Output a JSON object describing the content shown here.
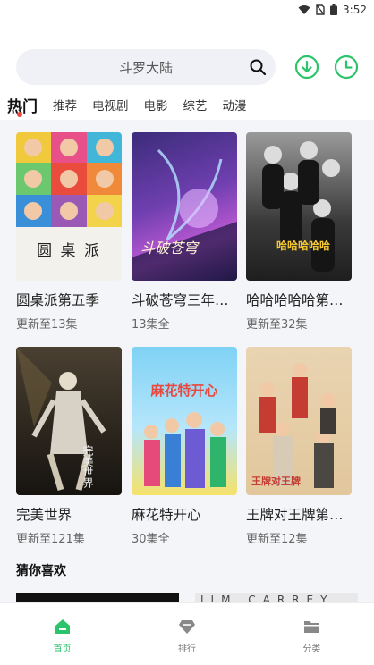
{
  "status_bar": {
    "time": "3:52"
  },
  "search": {
    "placeholder": "斗罗大陆"
  },
  "tabs": [
    {
      "label": "热门",
      "active": true
    },
    {
      "label": "推荐"
    },
    {
      "label": "电视剧"
    },
    {
      "label": "电影"
    },
    {
      "label": "综艺"
    },
    {
      "label": "动漫"
    }
  ],
  "cards": [
    {
      "title": "圆桌派第五季",
      "subtitle": "更新至13集",
      "poster_text": "圆 桌 派"
    },
    {
      "title": "斗破苍穹三年…",
      "subtitle": "13集全",
      "poster_text": "斗破苍穹"
    },
    {
      "title": "哈哈哈哈哈第…",
      "subtitle": "更新至32集",
      "poster_text": "哈哈哈哈哈"
    },
    {
      "title": "完美世界",
      "subtitle": "更新至121集",
      "poster_text": "完美世界"
    },
    {
      "title": "麻花特开心",
      "subtitle": "30集全",
      "poster_text": "麻花特开心"
    },
    {
      "title": "王牌对王牌第…",
      "subtitle": "更新至12集",
      "poster_text": "王牌对王牌"
    }
  ],
  "section": {
    "title": "猜你喜欢",
    "peek_text": "JIM CARREY"
  },
  "bottom_nav": [
    {
      "label": "首页",
      "icon": "home-icon",
      "active": true
    },
    {
      "label": "排行",
      "icon": "diamond-icon"
    },
    {
      "label": "分类",
      "icon": "folder-icon"
    }
  ],
  "colors": {
    "accent": "#2cc46b",
    "tab_dot": "#e8483f"
  }
}
